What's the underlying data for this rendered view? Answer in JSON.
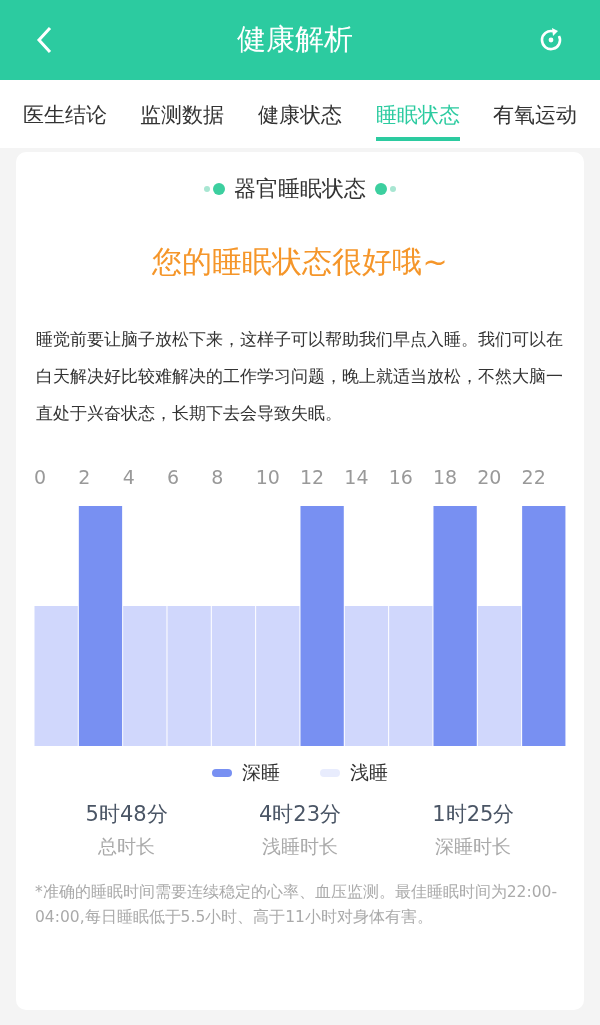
{
  "header": {
    "title": "健康解析"
  },
  "tabs": [
    {
      "label": "医生结论",
      "selected": false
    },
    {
      "label": "监测数据",
      "selected": false
    },
    {
      "label": "健康状态",
      "selected": false
    },
    {
      "label": "睡眠状态",
      "selected": true
    },
    {
      "label": "有氧运动",
      "selected": false
    }
  ],
  "section_title": "器官睡眠状态",
  "headline": "您的睡眠状态很好哦~",
  "advice": "睡觉前要让脑子放松下来，这样子可以帮助我们早点入睡。我们可以在白天解决好比较难解决的工作学习问题，晚上就适当放松，不然大脑一直处于兴奋状态，长期下去会导致失眠。",
  "sleep_chart": {
    "bars": [
      {
        "label": "0",
        "kind": "light"
      },
      {
        "label": "2",
        "kind": "deep"
      },
      {
        "label": "4",
        "kind": "light"
      },
      {
        "label": "6",
        "kind": "light"
      },
      {
        "label": "8",
        "kind": "light"
      },
      {
        "label": "10",
        "kind": "light"
      },
      {
        "label": "12",
        "kind": "deep"
      },
      {
        "label": "14",
        "kind": "light"
      },
      {
        "label": "16",
        "kind": "light"
      },
      {
        "label": "18",
        "kind": "deep"
      },
      {
        "label": "20",
        "kind": "light"
      },
      {
        "label": "22",
        "kind": "deep"
      }
    ],
    "legend": [
      {
        "kind": "deep",
        "label": "深睡"
      },
      {
        "kind": "light",
        "label": "浅睡"
      }
    ]
  },
  "stats": [
    {
      "value": "5时48分",
      "label": "总时长"
    },
    {
      "value": "4时23分",
      "label": "浅睡时长"
    },
    {
      "value": "1时25分",
      "label": "深睡时长"
    }
  ],
  "footnote": "*准确的睡眠时间需要连续稳定的心率、血压监测。最佳睡眠时间为22:00-04:00,每日睡眠低于5.5小时、高于11小时对身体有害。"
}
